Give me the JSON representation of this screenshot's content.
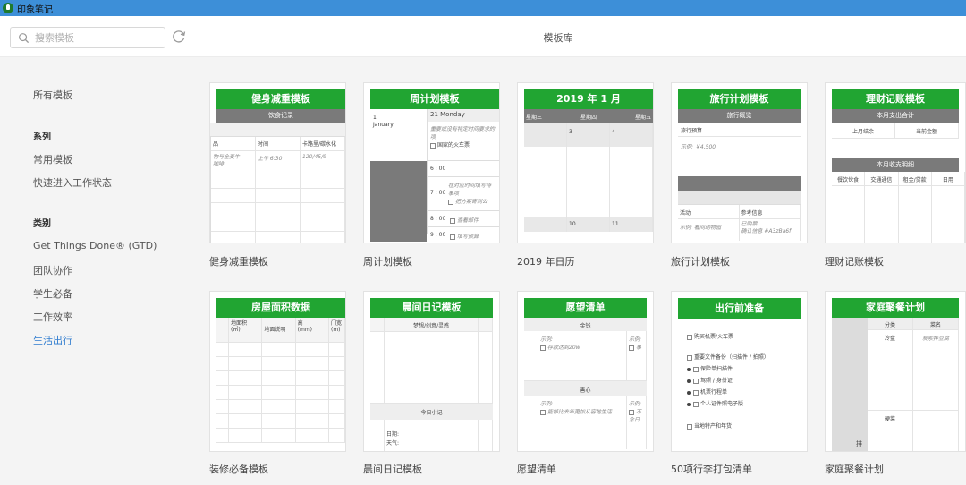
{
  "window": {
    "title": "印象笔记"
  },
  "search": {
    "placeholder": "搜索模板"
  },
  "page": {
    "title": "模板库"
  },
  "sidebar": {
    "all": "所有模板",
    "series_title": "系列",
    "series": [
      "常用模板",
      "快速进入工作状态"
    ],
    "category_title": "类别",
    "categories": [
      "Get Things Done® (GTD)",
      "团队协作",
      "学生必备",
      "工作效率",
      "生活出行"
    ]
  },
  "colors": {
    "accent_green": "#21a532",
    "active_blue": "#2f7ccf",
    "titlebar_blue": "#3d8fd8"
  },
  "templates": [
    {
      "label": "健身减重模板",
      "thumb": {
        "title": "健身减重模板",
        "sub": "饮食记录",
        "cols": [
          "品",
          "时间",
          "卡路里/碳水化"
        ],
        "r1": [
          "物与全麦牛",
          "上午 6:30",
          "120/45/9"
        ],
        "r1b": "咖啡"
      }
    },
    {
      "label": "周计划模板",
      "thumb": {
        "title": "周计划模板",
        "day": "21 Monday",
        "date1": "1",
        "date2": "January",
        "note": "重要或没有特定时间要求的",
        "note2": "项",
        "check1": "国家的火车票",
        "times": [
          "6 : 00",
          "7 : 00",
          "8 : 00",
          "9 : 00"
        ],
        "t7a": "在对应时间填写待",
        "t7b": "事项",
        "t7c": "把方案寄到公",
        "t8": "查看邮件",
        "t9": "填写预算"
      }
    },
    {
      "label": "2019 年日历",
      "thumb": {
        "title": "2019 年 1 月",
        "days": [
          "星期三",
          "星期四",
          "星期五"
        ],
        "n1": [
          "3",
          "4"
        ],
        "n2": [
          "10",
          "11"
        ]
      }
    },
    {
      "label": "旅行计划模板",
      "thumb": {
        "title": "旅行计划模板",
        "sub": "旅行概览",
        "budget": "旅行预算",
        "budget_ex": "示例: ￥4,500",
        "activity": "活动",
        "ref": "参考信息",
        "act_ex": "示例: 看间动物园",
        "ref_ex1": "已购票:",
        "ref_ex2": "确认信息 #A3zBa6f"
      }
    },
    {
      "label": "理财记账模板",
      "thumb": {
        "title": "理财记账模板",
        "sub": "本月支出合计",
        "bal1": "上月结余",
        "bal2": "当前金额",
        "sub2": "本月收支明细",
        "cols": [
          "餐饮伙食",
          "交通通信",
          "租金/贷款",
          "日用"
        ]
      }
    },
    {
      "label": "装修必备模板",
      "thumb": {
        "title": "房屋面积数据",
        "cols": [
          "地面积\n(㎡)",
          "地面说明",
          "高\n(mm)",
          "门宽\n(m)"
        ]
      }
    },
    {
      "label": "晨间日记模板",
      "thumb": {
        "title": "晨间日记模板",
        "sub": "梦想/创意/灵感",
        "sub2": "今日小记",
        "date": "日期:",
        "weather": "天气:"
      }
    },
    {
      "label": "愿望清单",
      "thumb": {
        "title": "愿望清单",
        "sec1": "金钱",
        "ex": "示例:",
        "item1": "存款达到20w",
        "item1b": "事",
        "sec2": "善心",
        "item2": "能够比去年更加从容地生活",
        "item2b": "不",
        "item2c": "念日"
      }
    },
    {
      "label": "50项行李打包清单",
      "thumb": {
        "title": "出行前准备",
        "items": [
          "购买机票/火车票",
          "重要文件备份（扫描件 / 拍照）",
          "保险单扫描件",
          "驾照 / 身份证",
          "机票行程单",
          "个人证件照电子版",
          "当地特产和年货"
        ]
      }
    },
    {
      "label": "家庭聚餐计划",
      "thumb": {
        "title": "家庭聚餐计划",
        "c1": "分类",
        "c2": "菜名",
        "r1": "冷盘",
        "r1ex": "炭索拌豆腐",
        "r2": "硬菜",
        "side": "排"
      }
    }
  ]
}
